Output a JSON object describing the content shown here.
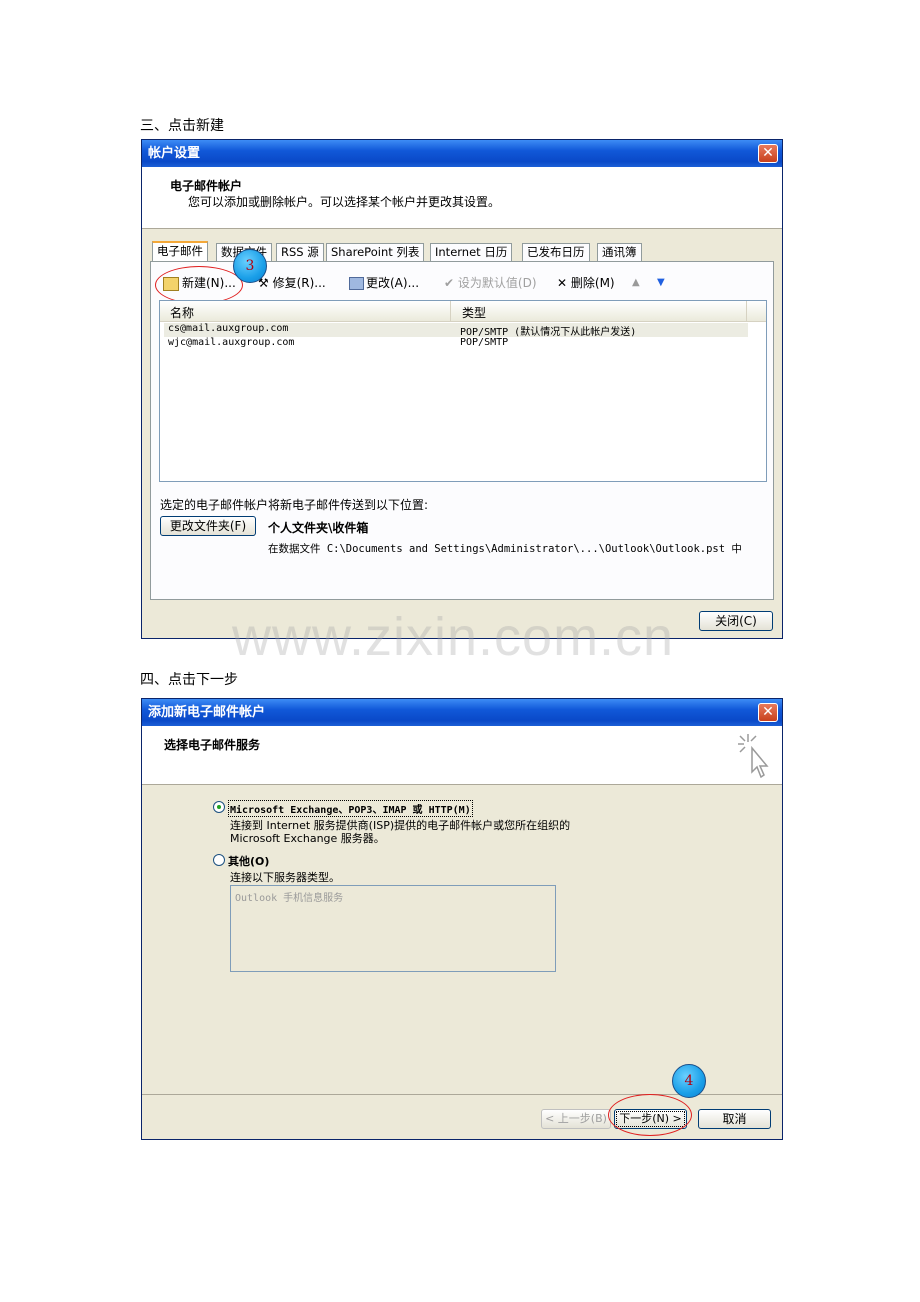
{
  "heading1": "三、点击新建",
  "heading2": "四、点击下一步",
  "watermark": "www.zixin.com.cn",
  "dialog1": {
    "title": "帐户设置",
    "close": "✕",
    "header_title": "电子邮件帐户",
    "header_sub": "您可以添加或删除帐户。可以选择某个帐户并更改其设置。",
    "tabs": [
      "电子邮件",
      "数据文件",
      "RSS 源",
      "SharePoint 列表",
      "Internet 日历",
      "已发布日历",
      "通讯簿"
    ],
    "toolbar": {
      "new": "新建(N)...",
      "repair": "修复(R)...",
      "change": "更改(A)...",
      "default": "设为默认值(D)",
      "delete": "删除(M)"
    },
    "list": {
      "col_name": "名称",
      "col_type": "类型",
      "rows": [
        {
          "name": "cs@mail.auxgroup.com",
          "type": "POP/SMTP (默认情况下从此帐户发送)"
        },
        {
          "name": "wjc@mail.auxgroup.com",
          "type": "POP/SMTP"
        }
      ]
    },
    "deliver_text": "选定的电子邮件帐户将新电子邮件传送到以下位置:",
    "change_folder": "更改文件夹(F)",
    "folder": "个人文件夹\\收件箱",
    "datafile": "在数据文件 C:\\Documents and Settings\\Administrator\\...\\Outlook\\Outlook.pst 中",
    "close_btn": "关闭(C)",
    "step": "3"
  },
  "dialog2": {
    "title": "添加新电子邮件帐户",
    "close": "✕",
    "header_title": "选择电子邮件服务",
    "opt1_label": "Microsoft Exchange、POP3、IMAP 或 HTTP(M)",
    "opt1_desc1": "连接到 Internet 服务提供商(ISP)提供的电子邮件帐户或您所在组织的",
    "opt1_desc2": "Microsoft Exchange 服务器。",
    "opt2_label": "其他(O)",
    "opt2_desc": "连接以下服务器类型。",
    "list_item": "Outlook 手机信息服务",
    "back": "< 上一步(B)",
    "next": "下一步(N) >",
    "cancel": "取消",
    "step": "4"
  }
}
